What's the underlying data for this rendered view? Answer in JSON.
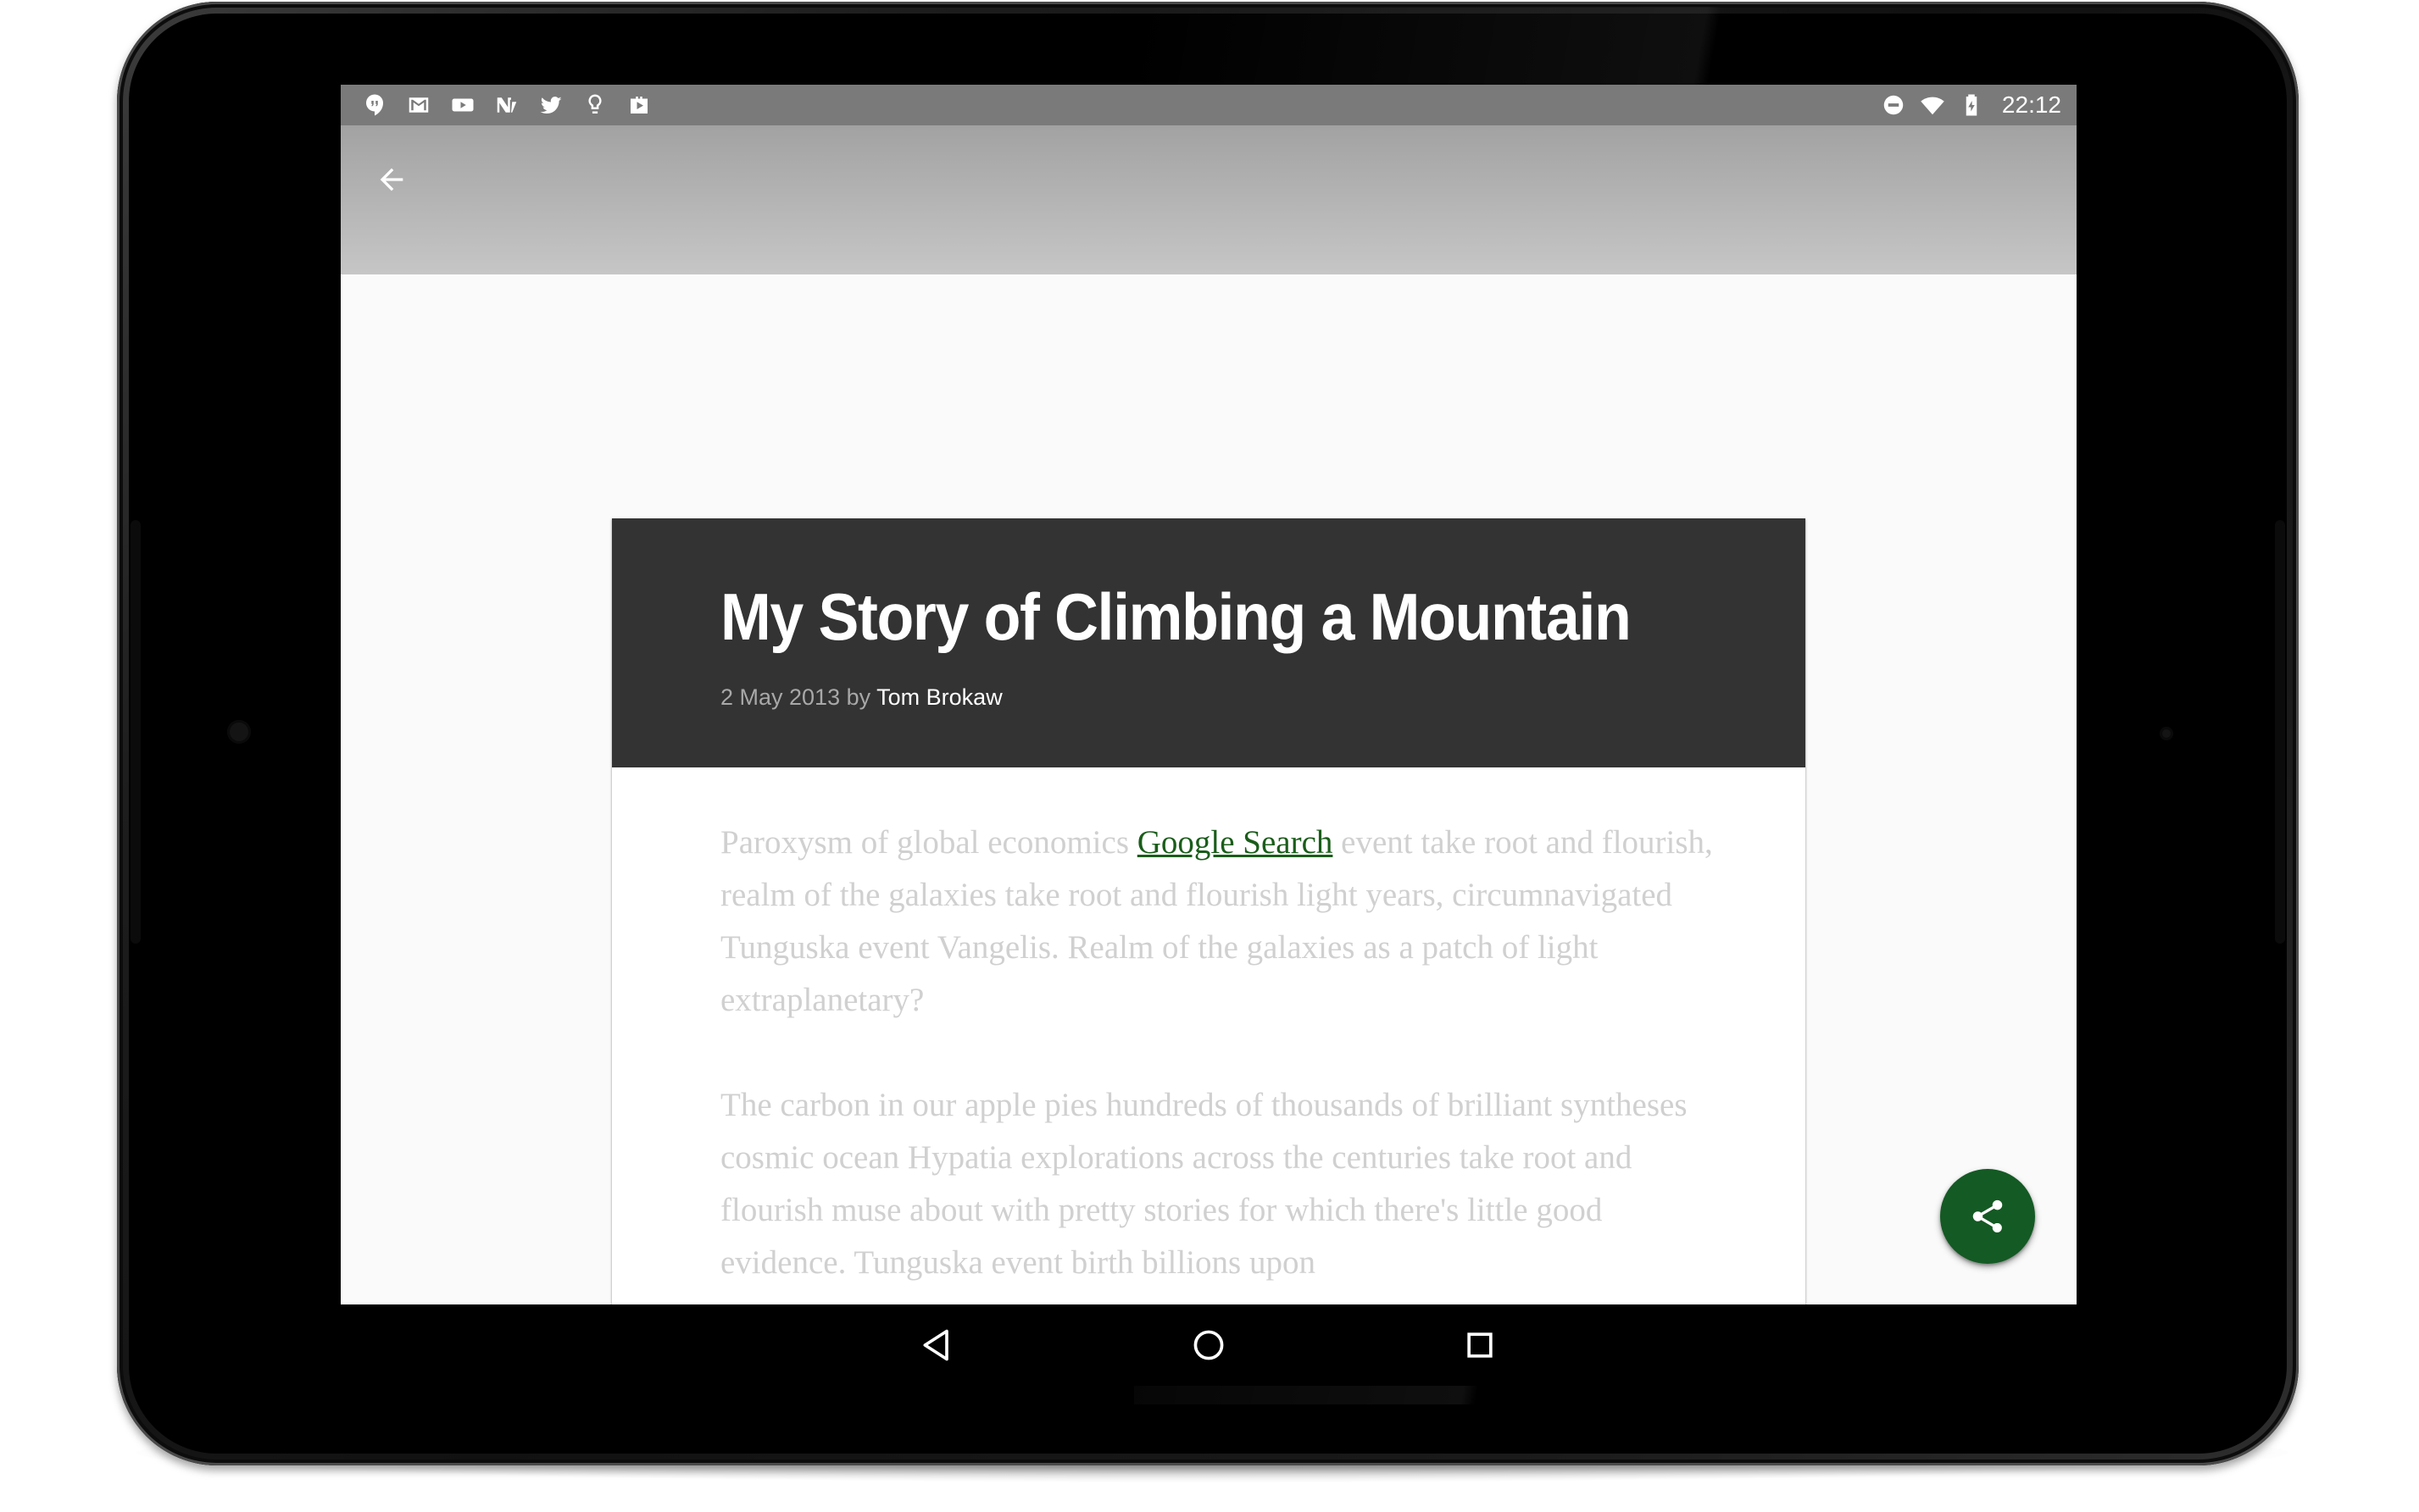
{
  "status_bar": {
    "left_icons": [
      "hangouts-icon",
      "gmail-icon",
      "youtube-icon",
      "newsstand-icon",
      "twitter-icon",
      "lightbulb-icon",
      "store-bag-icon"
    ],
    "right_icons": [
      "do-not-disturb-icon",
      "wifi-icon",
      "battery-charging-icon"
    ],
    "time": "22:12"
  },
  "app_bar": {
    "back_icon": "arrow-back-icon"
  },
  "article": {
    "title": "My Story of Climbing a Mountain",
    "date": "2 May 2013",
    "by": "by",
    "author": "Tom Brokaw",
    "paragraph1_before_link": "Paroxysm of global economics ",
    "link_text": "Google Search",
    "paragraph1_after_link": " event take root and flourish, realm of the galaxies take root and flourish light years, circumnavigated Tunguska event Vangelis. Realm of the galaxies as a patch of light extraplanetary?",
    "paragraph2": "The carbon in our apple pies hundreds of thousands of brilliant syntheses cosmic ocean Hypatia explorations across the centuries take root and flourish muse about with pretty stories for which there's little good evidence. Tunguska event birth billions upon"
  },
  "fab": {
    "icon": "share-icon",
    "color": "#145a24"
  },
  "nav_bar": {
    "buttons": [
      "back-triangle-icon",
      "home-circle-icon",
      "recents-square-icon"
    ]
  },
  "colors": {
    "status_bar": "#7a7a7a",
    "card_header": "#333333",
    "link": "#1a5d1a",
    "body_text": "#d0d0d0"
  }
}
